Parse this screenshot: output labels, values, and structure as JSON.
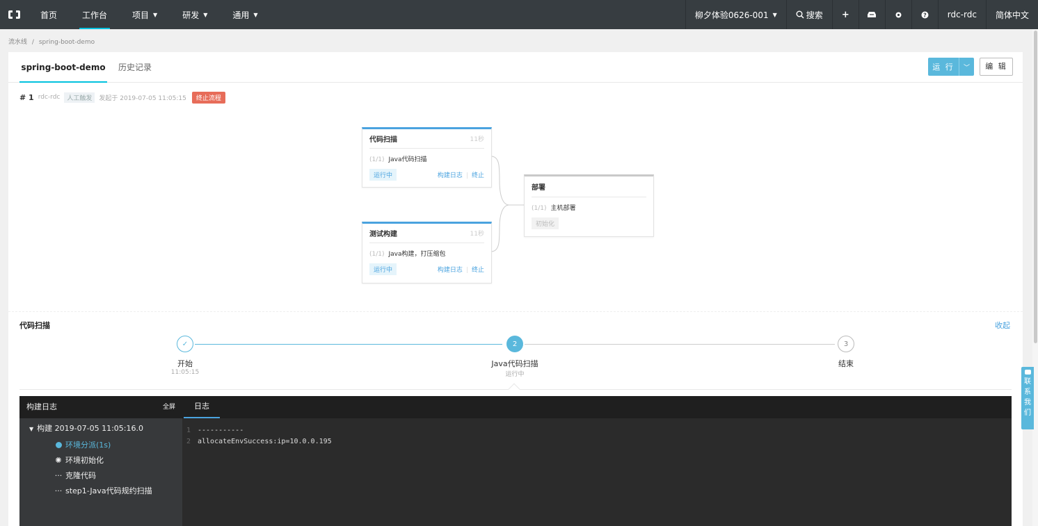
{
  "nav": {
    "logo_icon": "aliyun-logo-icon",
    "items": [
      "首页",
      "工作台",
      "项目",
      "研发",
      "通用"
    ],
    "right": {
      "org": "柳夕体验0626-001",
      "search": "搜索",
      "user": "rdc-rdc",
      "lang": "简体中文"
    }
  },
  "breadcrumb": [
    "流水线",
    "/",
    "spring-boot-demo"
  ],
  "tabs": [
    "spring-boot-demo",
    "历史记录"
  ],
  "actions": {
    "run": "运 行",
    "edit": "编 辑"
  },
  "run_info": {
    "number": "# 1",
    "user": "rdc-rdc",
    "trigger": "人工触发",
    "started": "发起于 2019-07-05 11:05:15",
    "stop": "终止流程"
  },
  "stages": [
    {
      "title": "代码扫描",
      "duration": "11秒",
      "count": "(1/1)",
      "task": "Java代码扫描",
      "status": "运行中",
      "log_link": "构建日志",
      "stop_link": "终止"
    },
    {
      "title": "测试构建",
      "duration": "11秒",
      "count": "(1/1)",
      "task": "Java构建，打压缩包",
      "status": "运行中",
      "log_link": "构建日志",
      "stop_link": "终止"
    },
    {
      "title": "部署",
      "count": "(1/1)",
      "task": "主机部署",
      "status": "初始化"
    }
  ],
  "detail": {
    "title": "代码扫描",
    "collapse": "收起",
    "steps": [
      {
        "label": "开始",
        "sub": "11:05:15",
        "marker": "✓"
      },
      {
        "label": "Java代码扫描",
        "sub": "运行中",
        "marker": "2"
      },
      {
        "label": "结束",
        "marker": "3"
      }
    ]
  },
  "log": {
    "panel_title": "构建日志",
    "fullscreen": "全屏",
    "tab": "日志",
    "tree_root": "构建 2019-07-05 11:05:16.0",
    "tree_items": [
      {
        "text": "环境分派(1s)",
        "icon": "check-circle-icon"
      },
      {
        "text": "环境初始化",
        "icon": "spinner-icon"
      },
      {
        "text": "克隆代码",
        "icon": "ellipsis-icon"
      },
      {
        "text": "step1-Java代码规约扫描",
        "icon": "ellipsis-icon"
      }
    ],
    "lines": [
      {
        "n": "1",
        "text": "-----------"
      },
      {
        "n": "2",
        "text": "allocateEnvSuccess:ip=10.0.0.195"
      }
    ]
  },
  "contact": "联系我们",
  "colors": {
    "nav_bg": "#373d41",
    "accent": "#5ab8dc",
    "danger": "#e76c59",
    "log_bg": "#2b2b2b"
  }
}
